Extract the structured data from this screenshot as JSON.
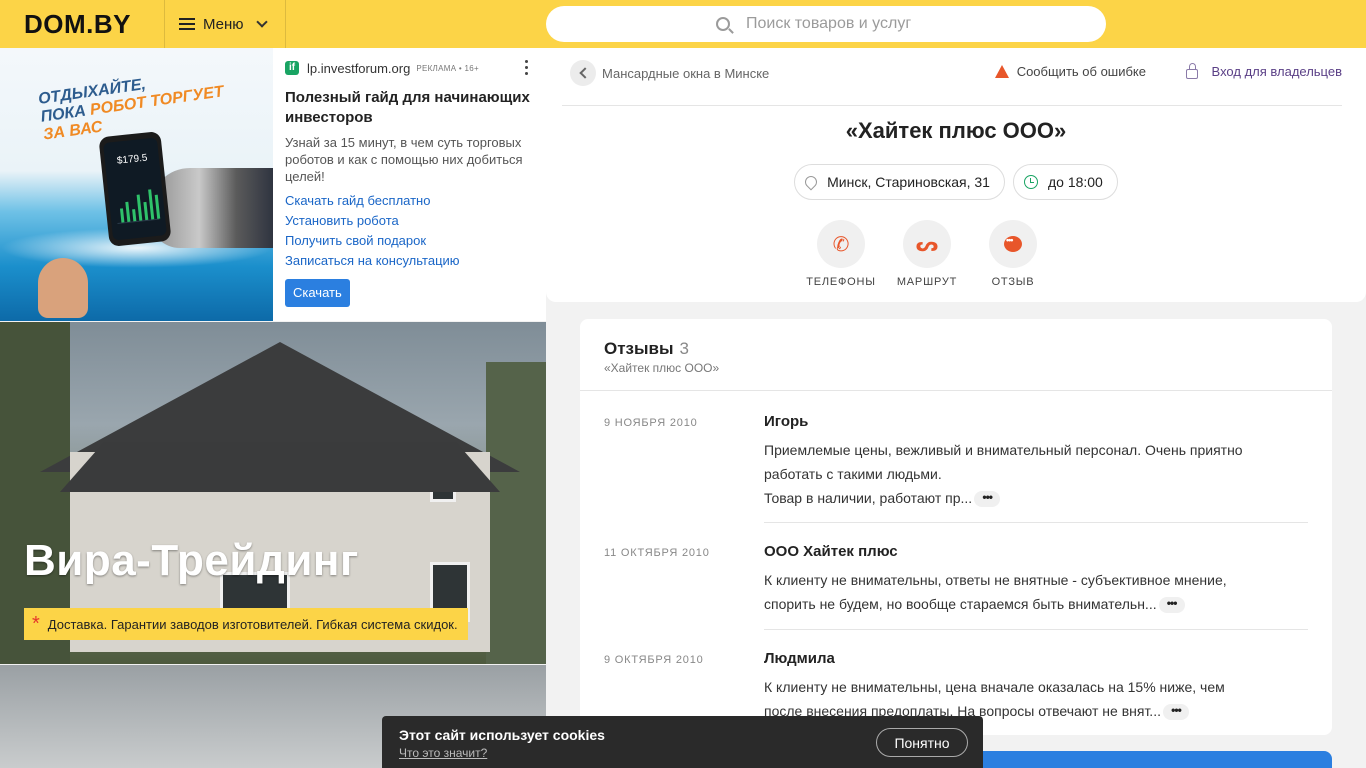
{
  "header": {
    "logo": "DOM.BY",
    "menu_label": "Меню",
    "search_placeholder": "Поиск товаров и услуг"
  },
  "ad": {
    "source": "lp.investforum.org",
    "tag": "РЕКЛАМА • 16+",
    "title": "Полезный гайд для начинающих инвесторов",
    "description": "Узнай за 15 минут, в чем суть торговых роботов и как с помощью них добиться целей!",
    "links": [
      "Скачать гайд бесплатно",
      "Установить робота",
      "Получить свой подарок",
      "Записаться на консультацию"
    ],
    "button_label": "Скачать",
    "image_slogan": {
      "line1": "ОТДЫХАЙТЕ,",
      "line2_a": "ПОКА ",
      "line2_b": "РОБОТ ТОРГУЕТ",
      "line3": "ЗА ВАС"
    },
    "phone_price": "$179.5"
  },
  "company_photo": {
    "name": "Вира-Трейдинг",
    "tagline": "Доставка. Гарантии заводов изготовителей. Гибкая система скидок."
  },
  "card": {
    "breadcrumb": "Мансардные окна в Минске",
    "report_label": "Сообщить об ошибке",
    "owner_label": "Вход для владельцев",
    "title": "«Хайтек плюс ООО»",
    "address": "Минск, Стариновская, 31",
    "hours": "до 18:00",
    "actions": [
      {
        "label": "ТЕЛЕФОНЫ",
        "icon": "phone-icon"
      },
      {
        "label": "МАРШРУТ",
        "icon": "route-icon"
      },
      {
        "label": "ОТЗЫВ",
        "icon": "chat-icon"
      }
    ]
  },
  "reviews": {
    "title": "Отзывы",
    "count": "3",
    "subtitle": "«Хайтек плюс ООО»",
    "items": [
      {
        "date": "9 НОЯБРЯ 2010",
        "author": "Игорь",
        "line1": "Приемлемые цены, вежливый и внимательный персонал. Очень приятно",
        "line2": "работать с такими людьми.",
        "line3": "Товар в наличии, работают пр..."
      },
      {
        "date": "11 ОКТЯБРЯ 2010",
        "author": "ООО Хайтек плюс",
        "line1": "К клиенту не внимательны, ответы не внятные - субъективное мнение,",
        "line2": "спорить не будем, но вообще стараемся быть внимательн..."
      },
      {
        "date": "9 ОКТЯБРЯ 2010",
        "author": "Людмила",
        "line1": "К клиенту не внимательны, цена вначале оказалась на 15% ниже, чем",
        "line2": "после внесения предоплаты. На вопросы отвечают не внят..."
      }
    ]
  },
  "cookie": {
    "title": "Этот сайт использует cookies",
    "link": "Что это значит?",
    "button": "Понятно"
  },
  "colors": {
    "header_bg": "#fcd447",
    "accent_orange": "#e8562a",
    "link_blue": "#1a66c7",
    "ad_button": "#2b7fe0"
  }
}
